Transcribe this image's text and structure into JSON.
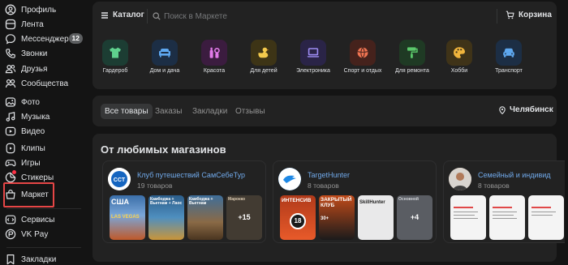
{
  "sidebar": {
    "items": [
      {
        "label": "Профиль",
        "icon": "profile-icon"
      },
      {
        "label": "Лента",
        "icon": "feed-icon"
      },
      {
        "label": "Мессенджер",
        "icon": "messenger-icon",
        "badge": "12"
      },
      {
        "label": "Звонки",
        "icon": "phone-icon"
      },
      {
        "label": "Друзья",
        "icon": "friends-icon"
      },
      {
        "label": "Сообщества",
        "icon": "communities-icon"
      },
      {
        "label": "Фото",
        "icon": "photo-icon"
      },
      {
        "label": "Музыка",
        "icon": "music-icon"
      },
      {
        "label": "Видео",
        "icon": "video-icon"
      },
      {
        "label": "Клипы",
        "icon": "clips-icon"
      },
      {
        "label": "Игры",
        "icon": "games-icon"
      },
      {
        "label": "Стикеры",
        "icon": "stickers-icon"
      },
      {
        "label": "Маркет",
        "icon": "market-icon"
      },
      {
        "label": "Сервисы",
        "icon": "services-icon"
      },
      {
        "label": "VK Pay",
        "icon": "vkpay-icon"
      },
      {
        "label": "Закладки",
        "icon": "bookmarks-icon"
      }
    ]
  },
  "topbar": {
    "catalog_label": "Каталог",
    "search_placeholder": "Поиск в Маркете",
    "cart_label": "Корзина"
  },
  "categories": [
    {
      "label": "Гардероб",
      "icon": "tshirt-icon",
      "color": "#1c3d33",
      "glyph": "#5fd18e"
    },
    {
      "label": "Дом и дача",
      "icon": "sofa-icon",
      "color": "#1c2e45",
      "glyph": "#5ea8f0"
    },
    {
      "label": "Красота",
      "icon": "cosmetics-icon",
      "color": "#3b1c3f",
      "glyph": "#e07ae8"
    },
    {
      "label": "Для детей",
      "icon": "duck-icon",
      "color": "#3d3416",
      "glyph": "#f2c94c"
    },
    {
      "label": "Электроника",
      "icon": "laptop-icon",
      "color": "#2a2447",
      "glyph": "#9d8cf2"
    },
    {
      "label": "Спорт и отдых",
      "icon": "ball-icon",
      "color": "#45221c",
      "glyph": "#f07452"
    },
    {
      "label": "Для ремонта",
      "icon": "roller-icon",
      "color": "#1f3a24",
      "glyph": "#5bc96b"
    },
    {
      "label": "Хобби",
      "icon": "palette-icon",
      "color": "#3f3318",
      "glyph": "#f0b43c"
    },
    {
      "label": "Транспорт",
      "icon": "car-icon",
      "color": "#1c2e45",
      "glyph": "#5ea8f0"
    }
  ],
  "tabs": [
    "Все товары",
    "Заказы",
    "Закладки",
    "Отзывы"
  ],
  "location": "Челябинск",
  "favorites": {
    "title": "От любимых магазинов",
    "stores": [
      {
        "name": "Клуб путешествий СамСебеТур",
        "count": "19 товаров",
        "thumbs": [
          {
            "text": "США\nLAS VEGAS",
            "bg": "#3a6ea8"
          },
          {
            "text": "Камбоджа +\nВьетнам +\nЛаос",
            "bg": "#2b5d8a"
          },
          {
            "text": "Камбоджа +\nВьетнам",
            "bg": "#7b5a3a"
          },
          {
            "text": "Марокко",
            "bg": "#5a4a3a",
            "more": "+15"
          }
        ]
      },
      {
        "name": "TargetHunter",
        "count": "8 товаров",
        "thumbs": [
          {
            "text": "ИНТЕНСИВ\n18",
            "bg": "#e85a2a"
          },
          {
            "text": "ЗАКРЫТЫЙ\nКЛУБ\n30+",
            "bg": "#e8772a"
          },
          {
            "text": "SkillHunter",
            "bg": "#e8e8e8"
          },
          {
            "text": "Основной",
            "bg": "#5a5d63",
            "more": "+4"
          }
        ]
      },
      {
        "name": "Семейный и индивид",
        "count": "8 товаров",
        "thumbs": [
          {
            "text": "",
            "bg": "#f2f2f2"
          },
          {
            "text": "",
            "bg": "#f2f2f2"
          },
          {
            "text": "",
            "bg": "#f2f2f2"
          },
          {
            "text": "",
            "bg": "#f2f2f2"
          }
        ]
      }
    ]
  }
}
